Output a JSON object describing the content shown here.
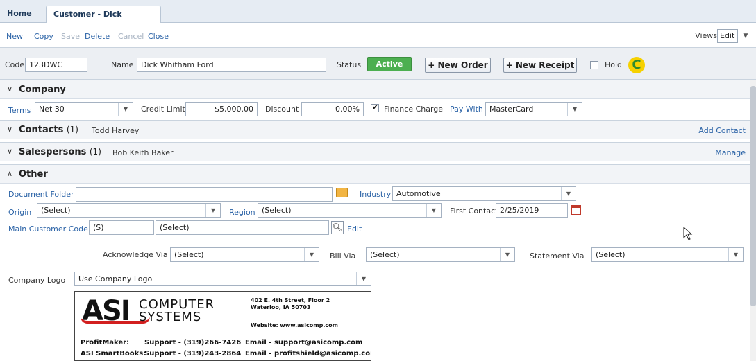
{
  "tabs": [
    {
      "label": "Home"
    },
    {
      "label": "Customer - Dick Whi..",
      "close": "✖"
    }
  ],
  "toolbar": {
    "new": "New",
    "copy": "Copy",
    "save": "Save",
    "delete": "Delete",
    "cancel": "Cancel",
    "close": "Close",
    "views_label": "Views",
    "views_value": "Edit"
  },
  "header": {
    "code_label": "Code",
    "code_value": "123DWC",
    "name_label": "Name",
    "name_value": "Dick Whitham Ford",
    "status_label": "Status",
    "status_value": "Active",
    "new_order": "+ New Order",
    "new_receipt": "+ New Receipt",
    "hold_label": "Hold",
    "hold_checked": false
  },
  "company": {
    "title": "Company",
    "terms_label": "Terms",
    "terms_value": "Net 30",
    "credit_limit_label": "Credit Limit",
    "credit_limit_value": "$5,000.00",
    "discount_label": "Discount",
    "discount_value": "0.00%",
    "finance_charge_label": "Finance Charge",
    "finance_charge_checked": true,
    "pay_with_label": "Pay With",
    "pay_with_value": "MasterCard"
  },
  "contacts": {
    "title": "Contacts",
    "count": "(1)",
    "summary": "Todd Harvey",
    "action": "Add Contact"
  },
  "salespersons": {
    "title": "Salespersons",
    "count": "(1)",
    "summary": "Bob Keith Baker",
    "action": "Manage"
  },
  "other": {
    "title": "Other",
    "document_folder_label": "Document Folder",
    "document_folder_value": "",
    "industry_label": "Industry",
    "industry_value": "Automotive",
    "origin_label": "Origin",
    "origin_value": "(Select)",
    "region_label": "Region",
    "region_value": "(Select)",
    "first_contact_label": "First Contact",
    "first_contact_value": "2/25/2019",
    "main_customer_code_label": "Main Customer Code",
    "main_customer_code_value": "(S)",
    "main_customer_select": "(Select)",
    "edit_label": "Edit",
    "acknowledge_label": "Acknowledge Via",
    "acknowledge_value": "(Select)",
    "bill_via_label": "Bill Via",
    "bill_via_value": "(Select)",
    "statement_via_label": "Statement Via",
    "statement_via_value": "(Select)",
    "company_logo_label": "Company Logo",
    "company_logo_value": "Use Company Logo"
  },
  "logo": {
    "mark": "ASI",
    "word1": "COMPUTER",
    "word2": "SYSTEMS",
    "addr1": "402 E. 4th Street, Floor 2",
    "addr2": "Waterloo, IA 50703",
    "website": "Website: www.asicomp.com",
    "lines": [
      {
        "product": "ProfitMaker:",
        "support": "Support - (319)266-7426",
        "email": "Email - support@asicomp.com"
      },
      {
        "product": "ASI SmartBooks:",
        "support": "Support - (319)243-2864",
        "email": "Email - profitshield@asicomp.com"
      }
    ]
  },
  "colors": {
    "accent": "#2a62a6",
    "active": "#4caf50"
  }
}
